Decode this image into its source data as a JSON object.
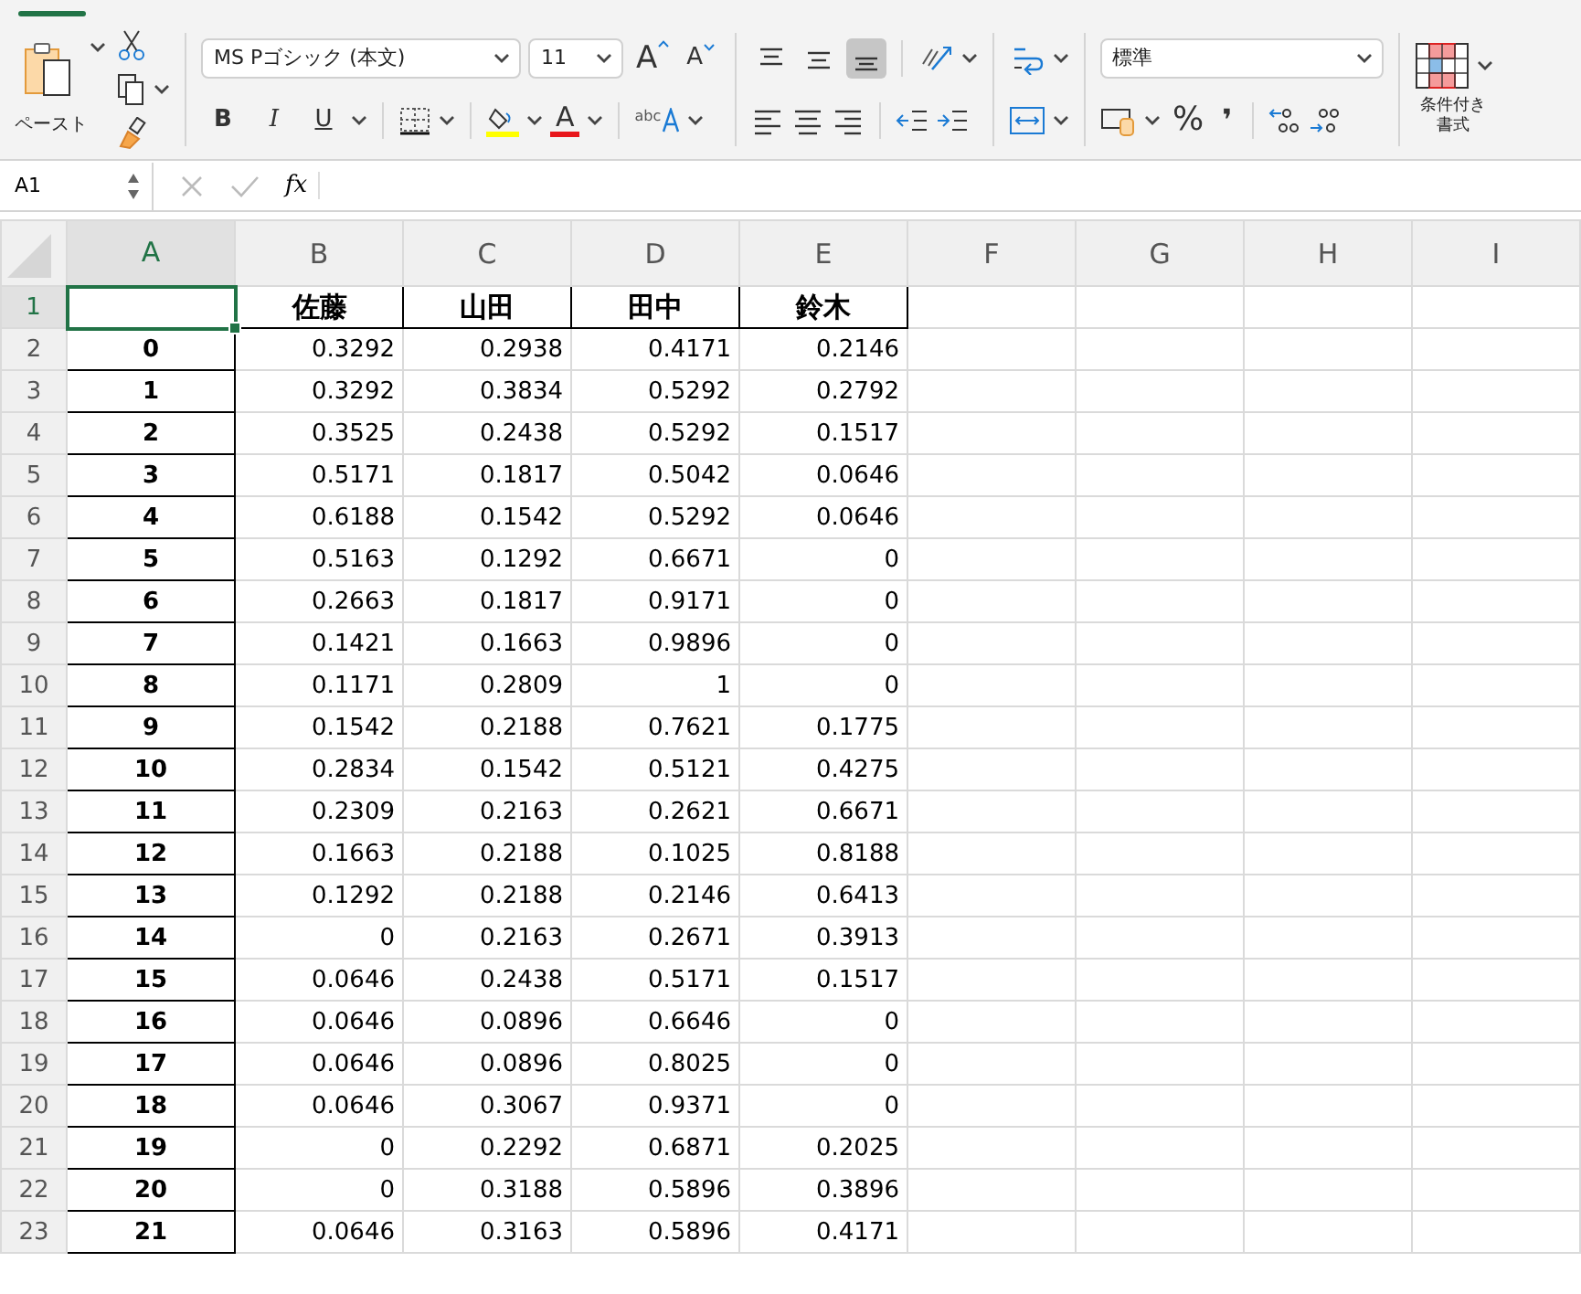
{
  "ribbon": {
    "paste_label": "ペースト",
    "font_name": "MS Pゴシック (本文)",
    "font_size": "11",
    "grow_font": "A",
    "shrink_font": "A",
    "bold": "B",
    "italic": "I",
    "underline": "U",
    "font_color": "A",
    "text_effects": "abc",
    "vertical_align": [
      {
        "selected": false
      },
      {
        "selected": false
      },
      {
        "selected": true
      }
    ],
    "number_format": "標準",
    "percent": "%",
    "comma": "❜",
    "conditional_format_label": "条件付き書式"
  },
  "formula_bar": {
    "name_box": "A1",
    "fx": "fx"
  },
  "columns": [
    {
      "label": "A",
      "selected": true
    },
    {
      "label": "B",
      "selected": false
    },
    {
      "label": "C",
      "selected": false
    },
    {
      "label": "D",
      "selected": false
    },
    {
      "label": "E",
      "selected": false
    },
    {
      "label": "F",
      "selected": false
    },
    {
      "label": "G",
      "selected": false
    },
    {
      "label": "H",
      "selected": false
    },
    {
      "label": "I",
      "selected": false
    }
  ],
  "rows": [
    {
      "kind": "header",
      "number": "1",
      "selected": true,
      "names": [
        "佐藤",
        "山田",
        "田中",
        "鈴木"
      ]
    },
    {
      "kind": "data",
      "number": "2",
      "selected": false,
      "index": "0",
      "values": [
        "0.3292",
        "0.2938",
        "0.4171",
        "0.2146"
      ]
    },
    {
      "kind": "data",
      "number": "3",
      "selected": false,
      "index": "1",
      "values": [
        "0.3292",
        "0.3834",
        "0.5292",
        "0.2792"
      ]
    },
    {
      "kind": "data",
      "number": "4",
      "selected": false,
      "index": "2",
      "values": [
        "0.3525",
        "0.2438",
        "0.5292",
        "0.1517"
      ]
    },
    {
      "kind": "data",
      "number": "5",
      "selected": false,
      "index": "3",
      "values": [
        "0.5171",
        "0.1817",
        "0.5042",
        "0.0646"
      ]
    },
    {
      "kind": "data",
      "number": "6",
      "selected": false,
      "index": "4",
      "values": [
        "0.6188",
        "0.1542",
        "0.5292",
        "0.0646"
      ]
    },
    {
      "kind": "data",
      "number": "7",
      "selected": false,
      "index": "5",
      "values": [
        "0.5163",
        "0.1292",
        "0.6671",
        "0"
      ]
    },
    {
      "kind": "data",
      "number": "8",
      "selected": false,
      "index": "6",
      "values": [
        "0.2663",
        "0.1817",
        "0.9171",
        "0"
      ]
    },
    {
      "kind": "data",
      "number": "9",
      "selected": false,
      "index": "7",
      "values": [
        "0.1421",
        "0.1663",
        "0.9896",
        "0"
      ]
    },
    {
      "kind": "data",
      "number": "10",
      "selected": false,
      "index": "8",
      "values": [
        "0.1171",
        "0.2809",
        "1",
        "0"
      ]
    },
    {
      "kind": "data",
      "number": "11",
      "selected": false,
      "index": "9",
      "values": [
        "0.1542",
        "0.2188",
        "0.7621",
        "0.1775"
      ]
    },
    {
      "kind": "data",
      "number": "12",
      "selected": false,
      "index": "10",
      "values": [
        "0.2834",
        "0.1542",
        "0.5121",
        "0.4275"
      ]
    },
    {
      "kind": "data",
      "number": "13",
      "selected": false,
      "index": "11",
      "values": [
        "0.2309",
        "0.2163",
        "0.2621",
        "0.6671"
      ]
    },
    {
      "kind": "data",
      "number": "14",
      "selected": false,
      "index": "12",
      "values": [
        "0.1663",
        "0.2188",
        "0.1025",
        "0.8188"
      ]
    },
    {
      "kind": "data",
      "number": "15",
      "selected": false,
      "index": "13",
      "values": [
        "0.1292",
        "0.2188",
        "0.2146",
        "0.6413"
      ]
    },
    {
      "kind": "data",
      "number": "16",
      "selected": false,
      "index": "14",
      "values": [
        "0",
        "0.2163",
        "0.2671",
        "0.3913"
      ]
    },
    {
      "kind": "data",
      "number": "17",
      "selected": false,
      "index": "15",
      "values": [
        "0.0646",
        "0.2438",
        "0.5171",
        "0.1517"
      ]
    },
    {
      "kind": "data",
      "number": "18",
      "selected": false,
      "index": "16",
      "values": [
        "0.0646",
        "0.0896",
        "0.6646",
        "0"
      ]
    },
    {
      "kind": "data",
      "number": "19",
      "selected": false,
      "index": "17",
      "values": [
        "0.0646",
        "0.0896",
        "0.8025",
        "0"
      ]
    },
    {
      "kind": "data",
      "number": "20",
      "selected": false,
      "index": "18",
      "values": [
        "0.0646",
        "0.3067",
        "0.9371",
        "0"
      ]
    },
    {
      "kind": "data",
      "number": "21",
      "selected": false,
      "index": "19",
      "values": [
        "0",
        "0.2292",
        "0.6871",
        "0.2025"
      ]
    },
    {
      "kind": "data",
      "number": "22",
      "selected": false,
      "index": "20",
      "values": [
        "0",
        "0.3188",
        "0.5896",
        "0.3896"
      ]
    },
    {
      "kind": "data",
      "number": "23",
      "selected": false,
      "index": "21",
      "values": [
        "0.0646",
        "0.3163",
        "0.5896",
        "0.4171"
      ]
    }
  ]
}
